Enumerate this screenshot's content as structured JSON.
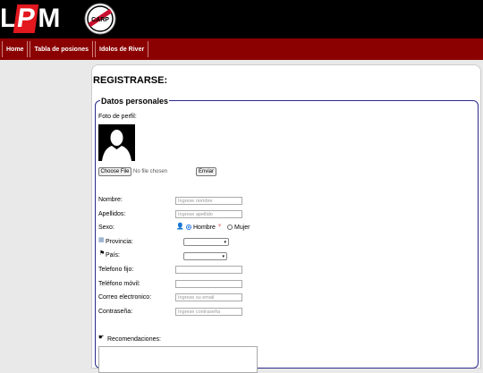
{
  "header": {
    "logo_left": "L",
    "logo_mid": "P",
    "logo_right": "M",
    "crest_text": "CARP"
  },
  "nav": {
    "items": [
      {
        "label": "Home"
      },
      {
        "label": "Tabla de posiones"
      },
      {
        "label": "Idolos de River"
      }
    ]
  },
  "main": {
    "title": "REGISTRARSE:",
    "legend": "Datos personales",
    "photo_label": "Foto de perfil:",
    "choose_file_label": "Choose File",
    "no_file_text": "No file chosen",
    "send_label": "Enviar",
    "fields": {
      "nombre": {
        "label": "Nombre:",
        "placeholder": "Ingrese nombre"
      },
      "apellidos": {
        "label": "Apellidos:",
        "placeholder": "Ingrese apellido"
      },
      "sexo": {
        "label": "Sexo:",
        "opt_male": "Hombre",
        "opt_female": "Mujer",
        "selected": "Hombre"
      },
      "provincia": {
        "label": "Provincia:",
        "value": ""
      },
      "pais": {
        "label": "País:",
        "value": ""
      },
      "telefono_fijo": {
        "label": "Telefono fijo:",
        "placeholder": ""
      },
      "telefono_movil": {
        "label": "Teléfono móvil:",
        "placeholder": ""
      },
      "correo": {
        "label": "Correo electronico:",
        "placeholder": "Ingrese su email"
      },
      "contrasena": {
        "label": "Contraseña:",
        "placeholder": "Ingrese contraseña"
      }
    },
    "recomendaciones_label": "Recomendaciones:"
  },
  "colors": {
    "nav_bg": "#8b0000",
    "topbar_bg": "#000000",
    "logo_red": "#e3171e",
    "fieldset_border": "#2a2a8c"
  }
}
